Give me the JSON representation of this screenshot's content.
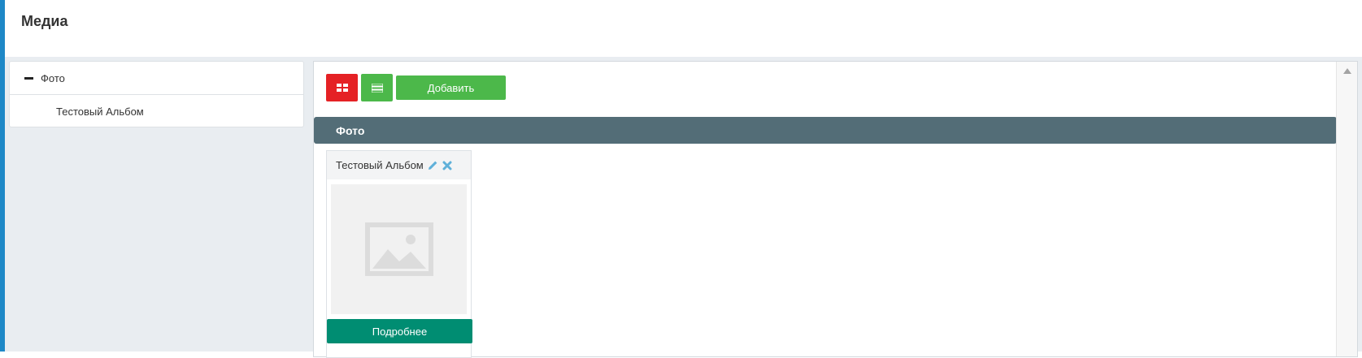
{
  "page": {
    "title": "Медиа",
    "accent_color": "#1e88c7"
  },
  "tree": {
    "root": {
      "label": "Фото",
      "expanded": true
    },
    "children": [
      {
        "label": "Тестовый Альбом"
      }
    ]
  },
  "toolbar": {
    "grid_view_icon": "grid-icon",
    "list_view_icon": "list-icon",
    "add_label": "Добавить"
  },
  "section": {
    "title": "Фото",
    "color": "#536d77"
  },
  "albums": [
    {
      "title": "Тестовый Альбом",
      "edit_icon": "pencil-icon",
      "delete_icon": "close-icon",
      "thumbnail_icon": "image-placeholder-icon",
      "more_label": "Подробнее"
    }
  ],
  "colors": {
    "red": "#e52125",
    "green": "#4cb84a",
    "teal": "#008d72",
    "icon_blue": "#5fb0d9"
  }
}
